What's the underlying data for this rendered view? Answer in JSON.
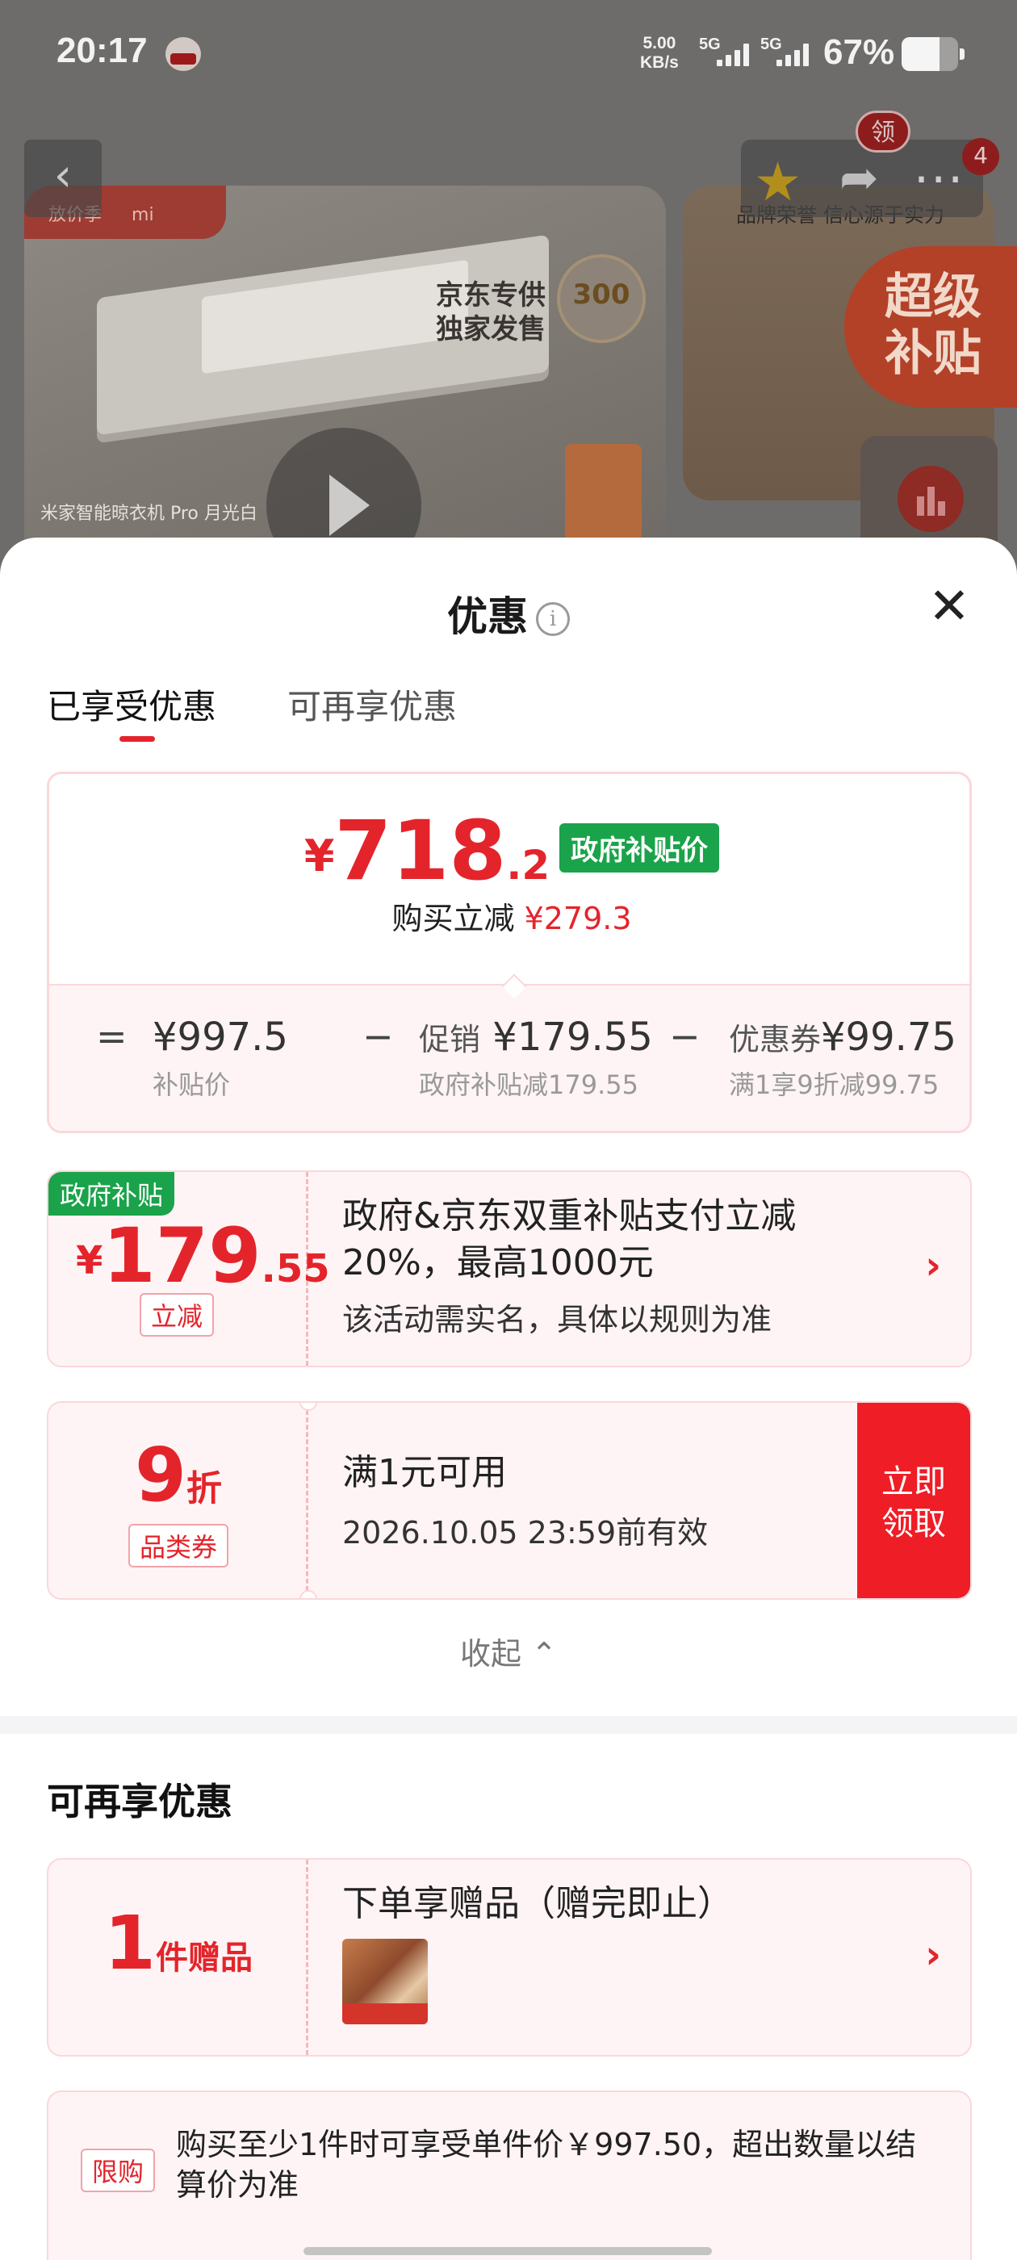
{
  "status_bar": {
    "time": "20:17",
    "net_speed_value": "5.00",
    "net_speed_unit": "KB/s",
    "signal1": "5G",
    "signal2": "5G",
    "battery_pct": "67%",
    "battery_level": 0.67
  },
  "background_page": {
    "product_name": "米家智能晾衣机 Pro 月光白",
    "tag_left": "放价季",
    "tag_brand": "mi",
    "jd_exclusive_line1": "京东专供",
    "jd_exclusive_line2": "独家发售",
    "badge_number": "300",
    "super_subsidy_line1": "超级",
    "super_subsidy_line2": "补贴",
    "brand_slogan": "品牌荣誉 信心源于实力",
    "coupon_badge": "领",
    "cart_count": "4",
    "icons": [
      "back-arrow-icon",
      "star-icon",
      "share-icon",
      "more-dots-icon",
      "chart-icon",
      "play-icon"
    ]
  },
  "sheet": {
    "title": "优惠",
    "info_symbol": "i",
    "close_symbol": "✕",
    "tabs": [
      {
        "label": "已享受优惠",
        "active": true
      },
      {
        "label": "可再享优惠",
        "active": false
      }
    ],
    "summary": {
      "currency": "¥",
      "price_int": "718",
      "price_dec": ".2",
      "price_tag": "政府补贴价",
      "reduce_label": "购买立减",
      "reduce_amount": "¥279.3",
      "eq": "=",
      "minus": "−",
      "base_value": "¥997.5",
      "base_sub": "补贴价",
      "promo_label": "促销",
      "promo_value": "¥179.55",
      "promo_sub": "政府补贴减179.55",
      "coupon_label": "优惠券",
      "coupon_value": "¥99.75",
      "coupon_sub": "满1享9折减99.75"
    },
    "subsidy_card": {
      "corner_tag": "政府补贴",
      "currency": "¥",
      "amount_int": "179",
      "amount_dec": ".55",
      "amount_tag": "立减",
      "title": "政府&京东双重补贴支付立减20%，最高1000元",
      "subtitle": "该活动需实名，具体以规则为准",
      "chevron": "›"
    },
    "discount_card": {
      "number": "9",
      "unit": "折",
      "type_tag": "品类券",
      "title": "满1元可用",
      "validity": "2026.10.05 23:59前有效",
      "claim_line1": "立即",
      "claim_line2": "领取"
    },
    "collapse_label": "收起 ⌃",
    "more_section": {
      "title": "可再享优惠",
      "gift_card": {
        "count": "1",
        "unit": "件赠品",
        "title": "下单享赠品（赠完即止）",
        "chevron": "›"
      },
      "limit_card": {
        "tag": "限购",
        "text": "购买至少1件时可享受单件价￥997.50，超出数量以结算价为准"
      }
    }
  },
  "colors": {
    "accent_red": "#e4242b",
    "gov_green": "#1aa34a",
    "card_bg": "#fff4f5",
    "card_border": "#fbd7da"
  }
}
